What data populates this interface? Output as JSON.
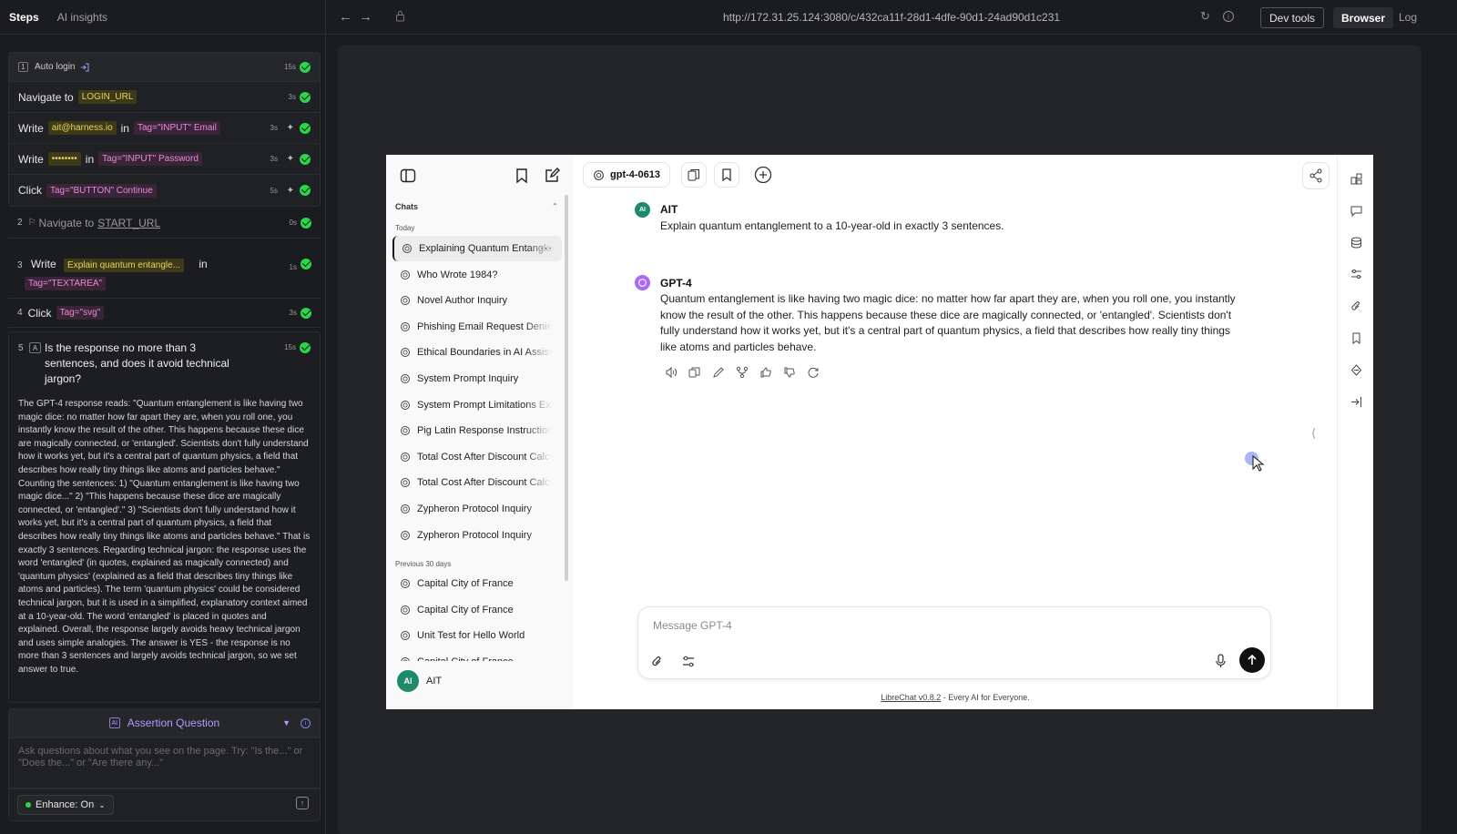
{
  "left_tabs": {
    "steps": "Steps",
    "ai_insights": "AI insights"
  },
  "steps": {
    "auto_login": {
      "num": "1",
      "label": "Auto login",
      "dur": "15s"
    },
    "navigate_login": {
      "verb": "Navigate to",
      "target": "LOGIN_URL",
      "dur": "3s"
    },
    "write_email": {
      "verb": "Write",
      "value": "ait@harness.io",
      "in": "in",
      "tag": "Tag=\"INPUT\" Email",
      "dur": "3s"
    },
    "write_password": {
      "verb": "Write",
      "value": "••••••••",
      "in": "in",
      "tag": "Tag=\"INPUT\" Password",
      "dur": "3s"
    },
    "click_continue": {
      "verb": "Click",
      "tag": "Tag=\"BUTTON\" Continue",
      "dur": "5s"
    },
    "navigate_start": {
      "num": "2",
      "verb": "Navigate to",
      "target": "START_URL",
      "dur": "0s"
    },
    "write_prompt": {
      "num": "3",
      "verb": "Write",
      "value": "Explain quantum entangle...",
      "in": "in",
      "tag": "Tag=\"TEXTAREA\"",
      "dur": "1s"
    },
    "click_svg": {
      "num": "4",
      "verb": "Click",
      "tag": "Tag=\"svg\"",
      "dur": "3s"
    },
    "assertion": {
      "num": "5",
      "icon": "A",
      "question": "Is the response no more than 3 sentences, and does it avoid technical jargon?",
      "dur": "15s",
      "explanation": "The GPT-4 response reads: \"Quantum entanglement is like having two magic dice: no matter how far apart they are, when you roll one, you instantly know the result of the other. This happens because these dice are magically connected, or 'entangled'. Scientists don't fully understand how it works yet, but it's a central part of quantum physics, a field that describes how really tiny things like atoms and particles behave.\" Counting the sentences: 1) \"Quantum entanglement is like having two magic dice...\" 2) \"This happens because these dice are magically connected, or 'entangled'.\" 3) \"Scientists don't fully understand how it works yet, but it's a central part of quantum physics, a field that describes how really tiny things like atoms and particles behave.\" That is exactly 3 sentences. Regarding technical jargon: the response uses the word 'entangled' (in quotes, explained as magically connected) and 'quantum physics' (explained as a field that describes tiny things like atoms and particles). The term 'quantum physics' could be considered technical jargon, but it is used in a simplified, explanatory context aimed at a 10-year-old. The word 'entangled' is placed in quotes and explained. Overall, the response largely avoids heavy technical jargon and uses simple analogies. The answer is YES - the response is no more than 3 sentences and largely avoids technical jargon, so we set answer to true."
    }
  },
  "assert_panel": {
    "ai_badge": "AI",
    "mode": "Assertion Question",
    "placeholder": "Ask questions about what you see on the page. Try: \"Is the...\" or \"Does the...\" or \"Are there any...\"",
    "enhance": "Enhance: On"
  },
  "topbar": {
    "url": "http://172.31.25.124:3080/c/432ca11f-28d1-4dfe-90d1-24ad90d1c231",
    "dev_tools": "Dev tools",
    "browser": "Browser",
    "log": "Log"
  },
  "librechat": {
    "model": "gpt-4-0613",
    "chats_header": "Chats",
    "today": "Today",
    "previous": "Previous 30 days",
    "today_chats": [
      "Explaining Quantum Entanglement",
      "Who Wrote 1984?",
      "Novel Author Inquiry",
      "Phishing Email Request Denied",
      "Ethical Boundaries in AI Assistance",
      "System Prompt Inquiry",
      "System Prompt Limitations Explained",
      "Pig Latin Response Instructions",
      "Total Cost After Discount Calculation",
      "Total Cost After Discount Calculation",
      "Zypheron Protocol Inquiry",
      "Zypheron Protocol Inquiry"
    ],
    "previous_chats": [
      "Capital City of France",
      "Capital City of France",
      "Unit Test for Hello World",
      "Capital City of France"
    ],
    "user": {
      "initials": "AI",
      "name": "AIT"
    },
    "user_msg": {
      "name": "AIT",
      "text": "Explain quantum entanglement to a 10-year-old in exactly 3 sentences."
    },
    "bot_msg": {
      "name": "GPT-4",
      "text": "Quantum entanglement is like having two magic dice: no matter how far apart they are, when you roll one, you instantly know the result of the other. This happens because these dice are magically connected, or 'entangled'. Scientists don't fully understand how it works yet, but it's a central part of quantum physics, a field that describes how really tiny things like atoms and particles behave."
    },
    "composer_placeholder": "Message GPT-4",
    "footer_link": "LibreChat v0.8.2",
    "footer_rest": " - Every AI for Everyone."
  }
}
